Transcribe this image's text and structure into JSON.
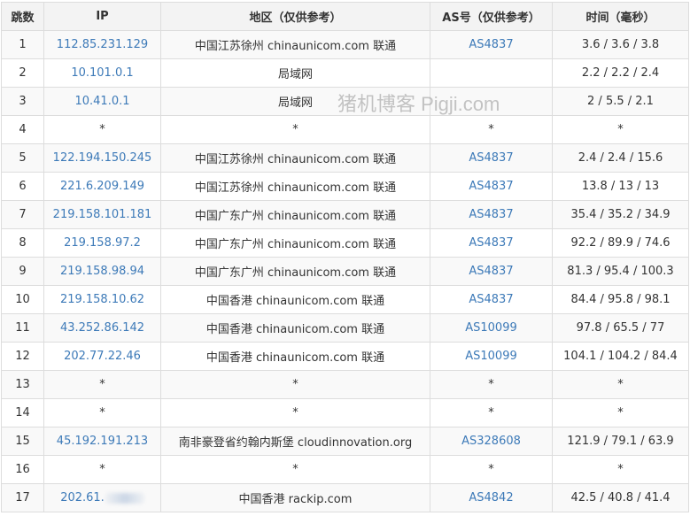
{
  "table": {
    "headers": [
      "跳数",
      "IP",
      "地区（仅供参考）",
      "AS号（仅供参考）",
      "时间（毫秒）"
    ],
    "rows": [
      {
        "hop": "1",
        "ip": "112.85.231.129",
        "region": "中国江苏徐州 chinaunicom.com 联通",
        "asn": "AS4837",
        "time": "3.6 / 3.6 / 3.8"
      },
      {
        "hop": "2",
        "ip": "10.101.0.1",
        "region": "局域网",
        "asn": "",
        "time": "2.2 / 2.2 / 2.4"
      },
      {
        "hop": "3",
        "ip": "10.41.0.1",
        "region": "局域网",
        "asn": "",
        "time": "2 / 5.5 / 2.1"
      },
      {
        "hop": "4",
        "ip": "*",
        "region": "*",
        "asn": "*",
        "time": "*"
      },
      {
        "hop": "5",
        "ip": "122.194.150.245",
        "region": "中国江苏徐州 chinaunicom.com 联通",
        "asn": "AS4837",
        "time": "2.4 / 2.4 / 15.6"
      },
      {
        "hop": "6",
        "ip": "221.6.209.149",
        "region": "中国江苏徐州 chinaunicom.com 联通",
        "asn": "AS4837",
        "time": "13.8 / 13 / 13"
      },
      {
        "hop": "7",
        "ip": "219.158.101.181",
        "region": "中国广东广州 chinaunicom.com 联通",
        "asn": "AS4837",
        "time": "35.4 / 35.2 / 34.9"
      },
      {
        "hop": "8",
        "ip": "219.158.97.2",
        "region": "中国广东广州 chinaunicom.com 联通",
        "asn": "AS4837",
        "time": "92.2 / 89.9 / 74.6"
      },
      {
        "hop": "9",
        "ip": "219.158.98.94",
        "region": "中国广东广州 chinaunicom.com 联通",
        "asn": "AS4837",
        "time": "81.3 / 95.4 / 100.3"
      },
      {
        "hop": "10",
        "ip": "219.158.10.62",
        "region": "中国香港 chinaunicom.com 联通",
        "asn": "AS4837",
        "time": "84.4 / 95.8 / 98.1"
      },
      {
        "hop": "11",
        "ip": "43.252.86.142",
        "region": "中国香港 chinaunicom.com 联通",
        "asn": "AS10099",
        "time": "97.8 / 65.5 / 77"
      },
      {
        "hop": "12",
        "ip": "202.77.22.46",
        "region": "中国香港 chinaunicom.com 联通",
        "asn": "AS10099",
        "time": "104.1 / 104.2 / 84.4"
      },
      {
        "hop": "13",
        "ip": "*",
        "region": "*",
        "asn": "*",
        "time": "*"
      },
      {
        "hop": "14",
        "ip": "*",
        "region": "*",
        "asn": "*",
        "time": "*"
      },
      {
        "hop": "15",
        "ip": "45.192.191.213",
        "region": "南非豪登省约翰内斯堡 cloudinnovation.org",
        "asn": "AS328608",
        "time": "121.9 / 79.1 / 63.9"
      },
      {
        "hop": "16",
        "ip": "*",
        "region": "*",
        "asn": "*",
        "time": "*"
      },
      {
        "hop": "17",
        "ip": "202.61.",
        "region": "中国香港 rackip.com",
        "asn": "AS4842",
        "time": "42.5 / 40.8 / 41.4",
        "ip_redacted": true
      }
    ]
  },
  "watermark": "猪机博客 Pigji.com",
  "colors": {
    "link": "#3d7ab8",
    "header_bg": "#f3f3f3",
    "row_odd_bg": "#f9f9f9",
    "row_even_bg": "#ffffff",
    "border": "#dddddd"
  }
}
